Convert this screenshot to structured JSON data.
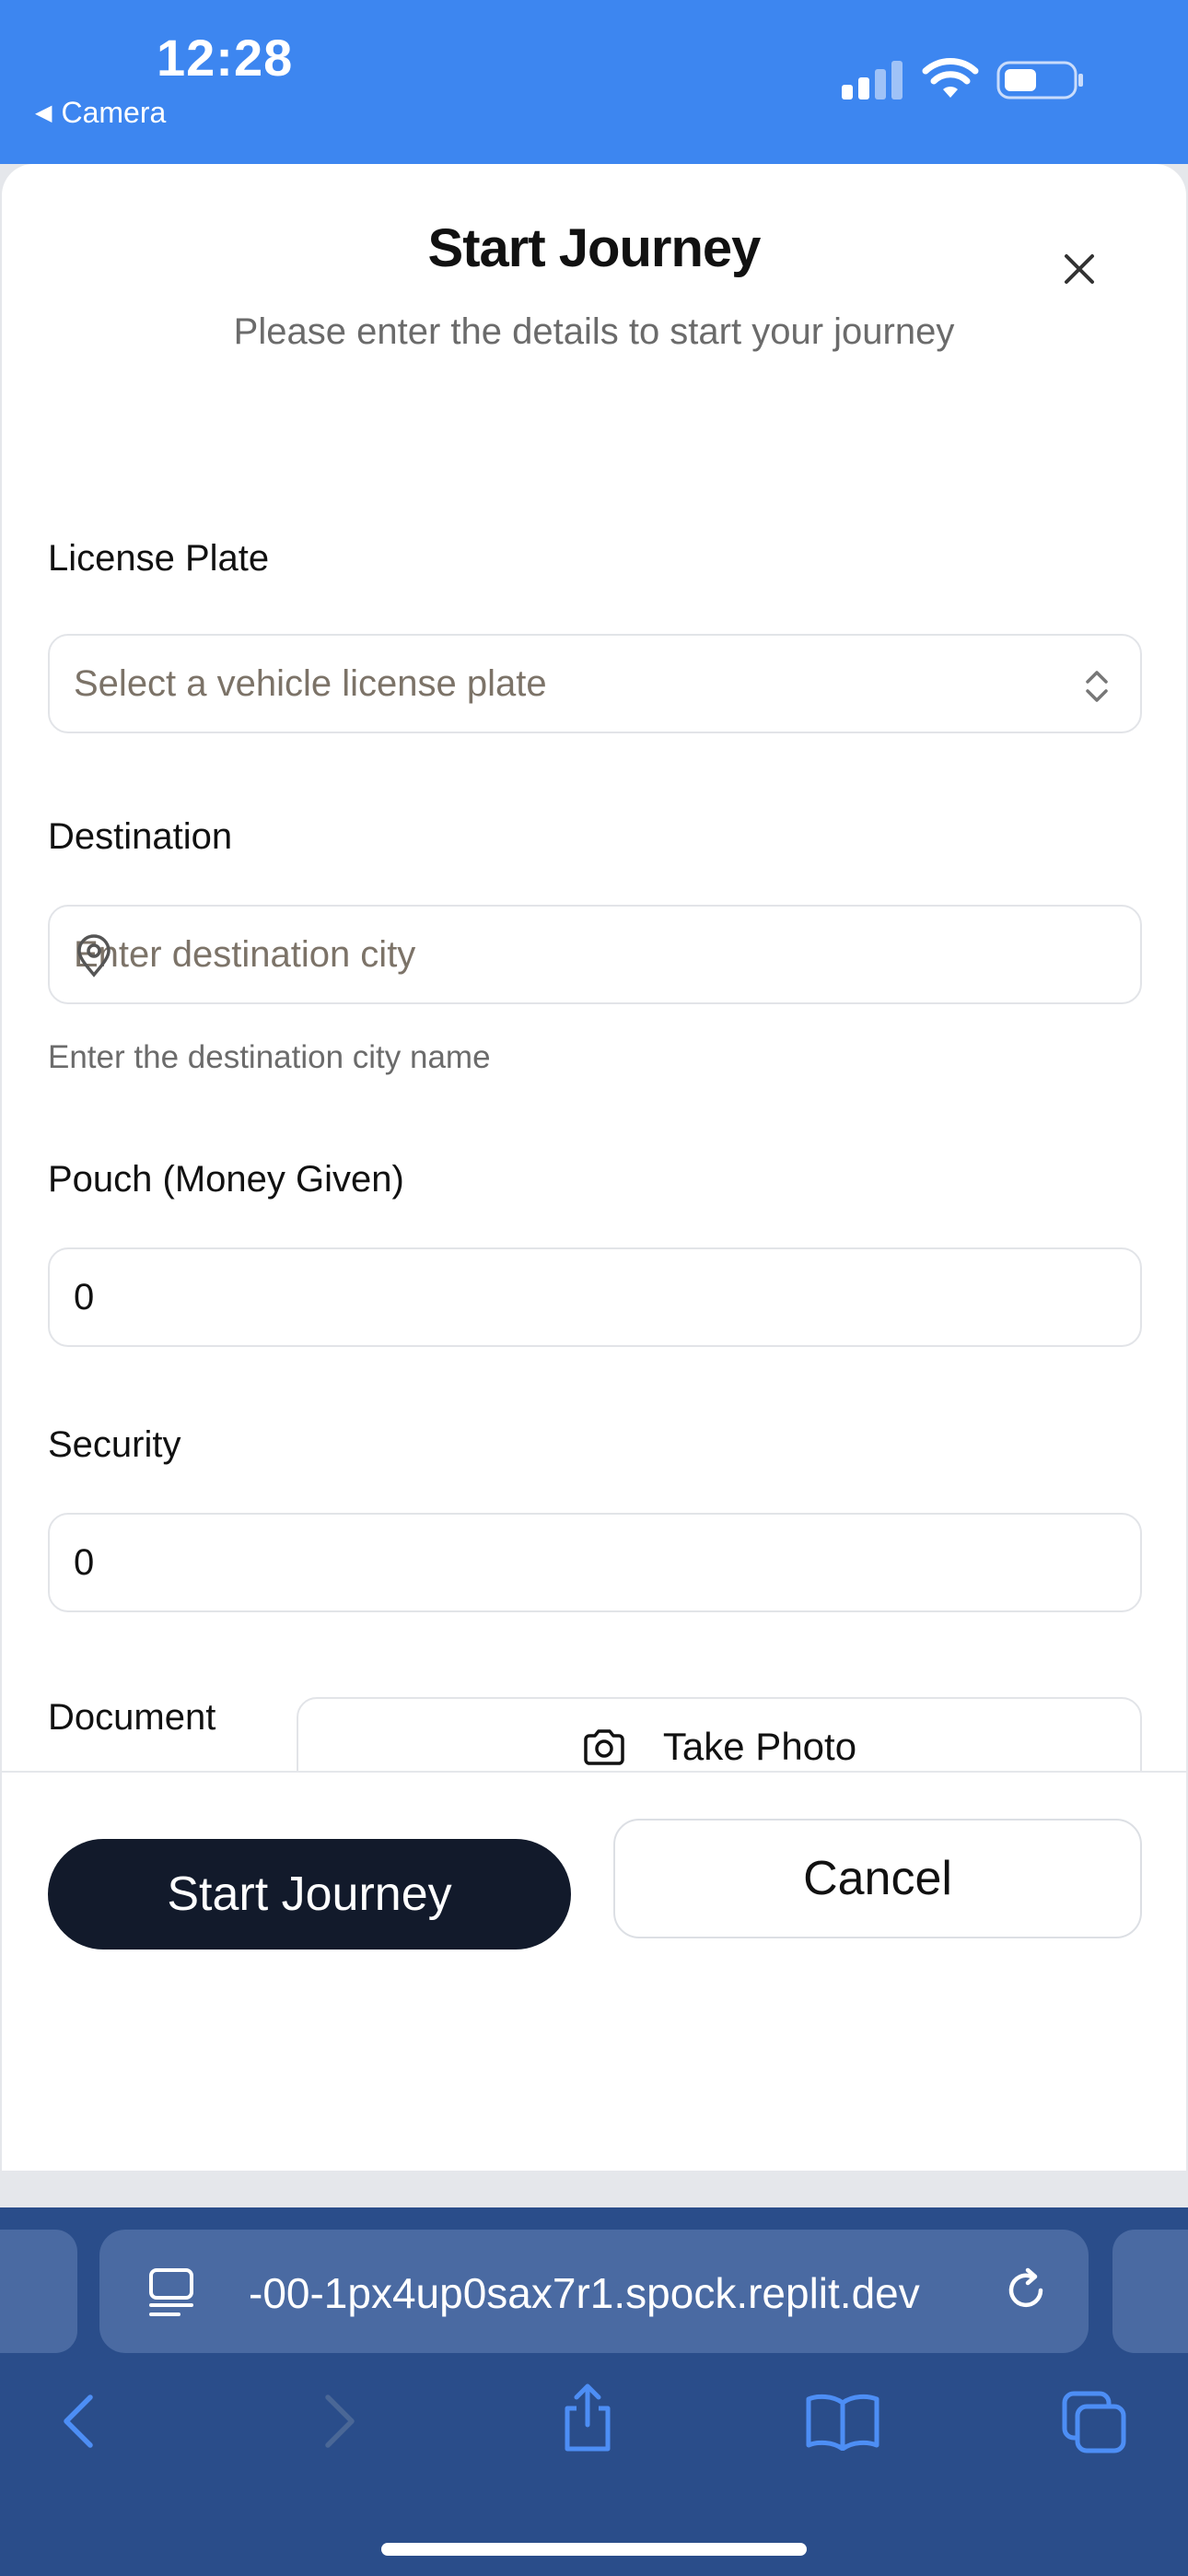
{
  "status_bar": {
    "time": "12:28",
    "back_app": "Camera"
  },
  "modal": {
    "title": "Start Journey",
    "subtitle": "Please enter the details to start your journey",
    "license_plate": {
      "label": "License Plate",
      "placeholder": "Select a vehicle license plate"
    },
    "destination": {
      "label": "Destination",
      "placeholder": "Enter destination city",
      "helper": "Enter the destination city name"
    },
    "pouch": {
      "label": "Pouch (Money Given)",
      "value": "0"
    },
    "security": {
      "label": "Security",
      "value": "0"
    },
    "document_photo": {
      "label": "Document Photo",
      "button": "Take Photo"
    },
    "start_button": "Start Journey",
    "cancel_button": "Cancel"
  },
  "browser": {
    "url": "-00-1px4up0sax7r1.spock.replit.dev"
  },
  "colors": {
    "status_bar": "#3d86f0",
    "primary_button": "#121a2b",
    "browser_chrome": "#2a4d8a"
  }
}
